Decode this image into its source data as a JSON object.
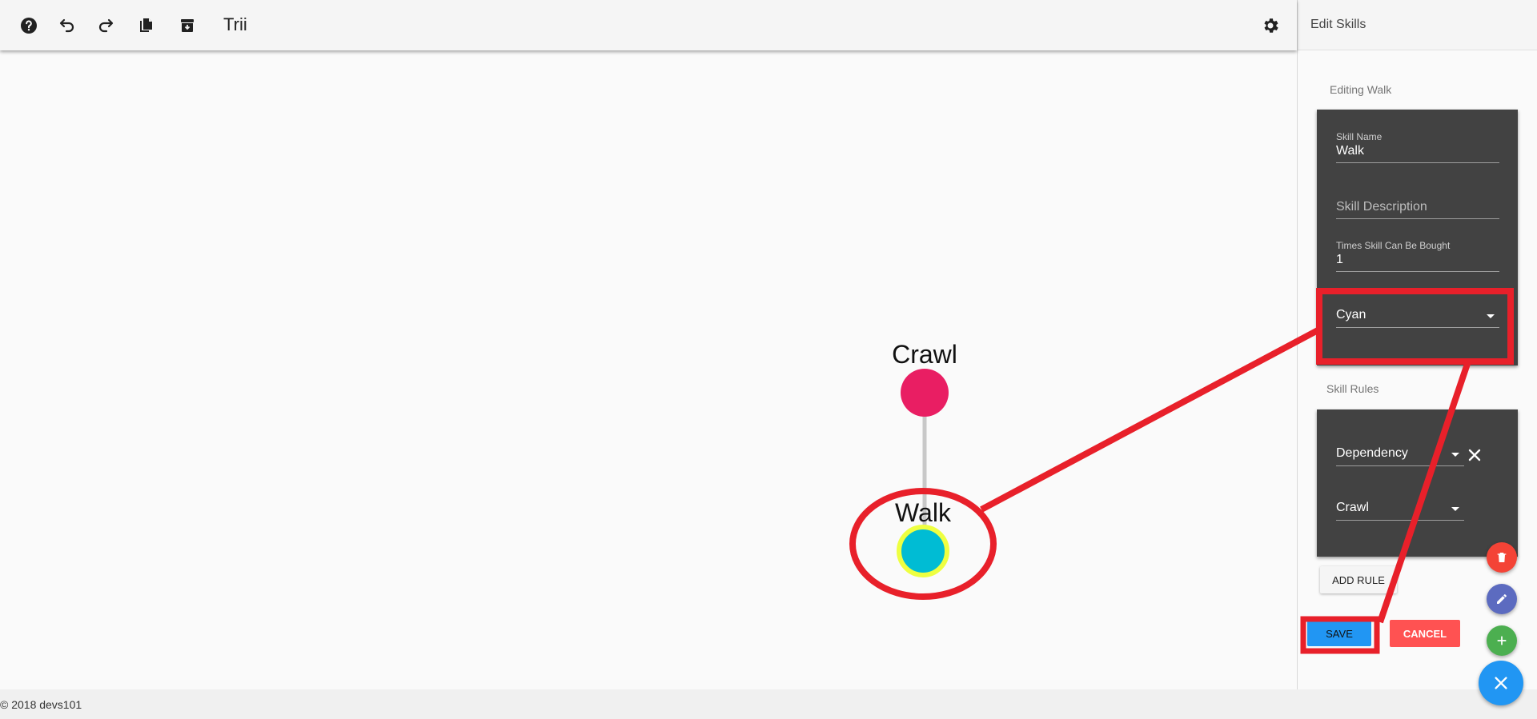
{
  "toolbar": {
    "title": "Trii",
    "icons": [
      "help-icon",
      "undo-icon",
      "redo-icon",
      "copy-icon",
      "archive-icon",
      "gear-icon"
    ]
  },
  "tree": {
    "nodes": [
      {
        "label": "Crawl",
        "color": "#e91e63"
      },
      {
        "label": "Walk",
        "color": "#00bcd4",
        "ring": "#eeff41"
      }
    ],
    "edge_color": "#c8c8c8"
  },
  "panel": {
    "header": "Edit Skills",
    "editing_label": "Editing Walk",
    "skill_name_label": "Skill Name",
    "skill_name_value": "Walk",
    "skill_description_placeholder": "Skill Description",
    "times_label": "Times Skill Can Be Bought",
    "times_value": "1",
    "color_value": "Cyan",
    "rules_label": "Skill Rules",
    "rule_type_value": "Dependency",
    "rule_target_value": "Crawl",
    "add_rule_label": "ADD RULE",
    "save_label": "SAVE",
    "cancel_label": "CANCEL"
  },
  "fabs": [
    {
      "name": "delete",
      "color": "#f44336"
    },
    {
      "name": "edit",
      "color": "#5c6bc0"
    },
    {
      "name": "add",
      "color": "#4caf50"
    },
    {
      "name": "close",
      "color": "#2196f3"
    }
  ],
  "footer": {
    "copyright": "© 2018 devs101"
  },
  "colors": {
    "accent_blue": "#2196f3",
    "cancel_red": "#ff5252",
    "annotation_red": "#e8202a",
    "card_dark": "#424242"
  }
}
